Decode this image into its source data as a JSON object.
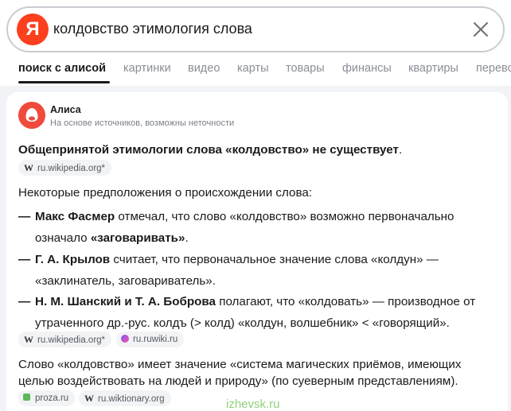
{
  "search": {
    "logo": "Я",
    "query": "колдовство этимология слова",
    "clear_icon": "close-icon"
  },
  "tabs": [
    {
      "label": "поиск с алисой",
      "active": true
    },
    {
      "label": "картинки"
    },
    {
      "label": "видео"
    },
    {
      "label": "карты"
    },
    {
      "label": "товары"
    },
    {
      "label": "финансы"
    },
    {
      "label": "квартиры"
    },
    {
      "label": "перево"
    }
  ],
  "answer": {
    "source_name": "Алиса",
    "source_note": "На основе источников, возможны неточности",
    "headline_bold": "Общепринятой этимологии слова «колдовство» не существует",
    "headline_tail": ".",
    "headline_source": "ru.wikipedia.org*",
    "intro": "Некоторые предположения о происхождении слова:",
    "items": [
      {
        "dash": "—",
        "bold": "Макс Фасмер",
        "text": " отмечал, что слово «колдовство» возможно первоначально означало ",
        "bold2": "«заговаривать»",
        "tail": "."
      },
      {
        "dash": "—",
        "bold": "Г. А. Крылов",
        "text": " считает, что первоначальное значение слова «колдун» — «заклинатель, заговариватель»."
      },
      {
        "dash": "—",
        "bold": "Н. М. Шанский и Т. А. Боброва",
        "text": " полагают, что «колдовать» — производное от утраченного др.-рус. колдъ (> колд) «колдун, волшебник» < «говорящий»."
      }
    ],
    "list_sources": [
      "ru.wikipedia.org*",
      "ru.ruwiki.ru"
    ],
    "closing": "Слово «колдовство» имеет значение «система магических приёмов, имеющих целью воздействовать на людей и природу» (по суеверным представлениям).",
    "closing_sources": [
      "proza.ru",
      "ru.wiktionary.org"
    ]
  },
  "watermark": "izhevsk.ru",
  "colors": {
    "yandex_red": "#fc3f1d",
    "alisa_red": "#f04a3c",
    "muted_text": "#8a8e96",
    "watermark_green": "#8fd17a"
  }
}
